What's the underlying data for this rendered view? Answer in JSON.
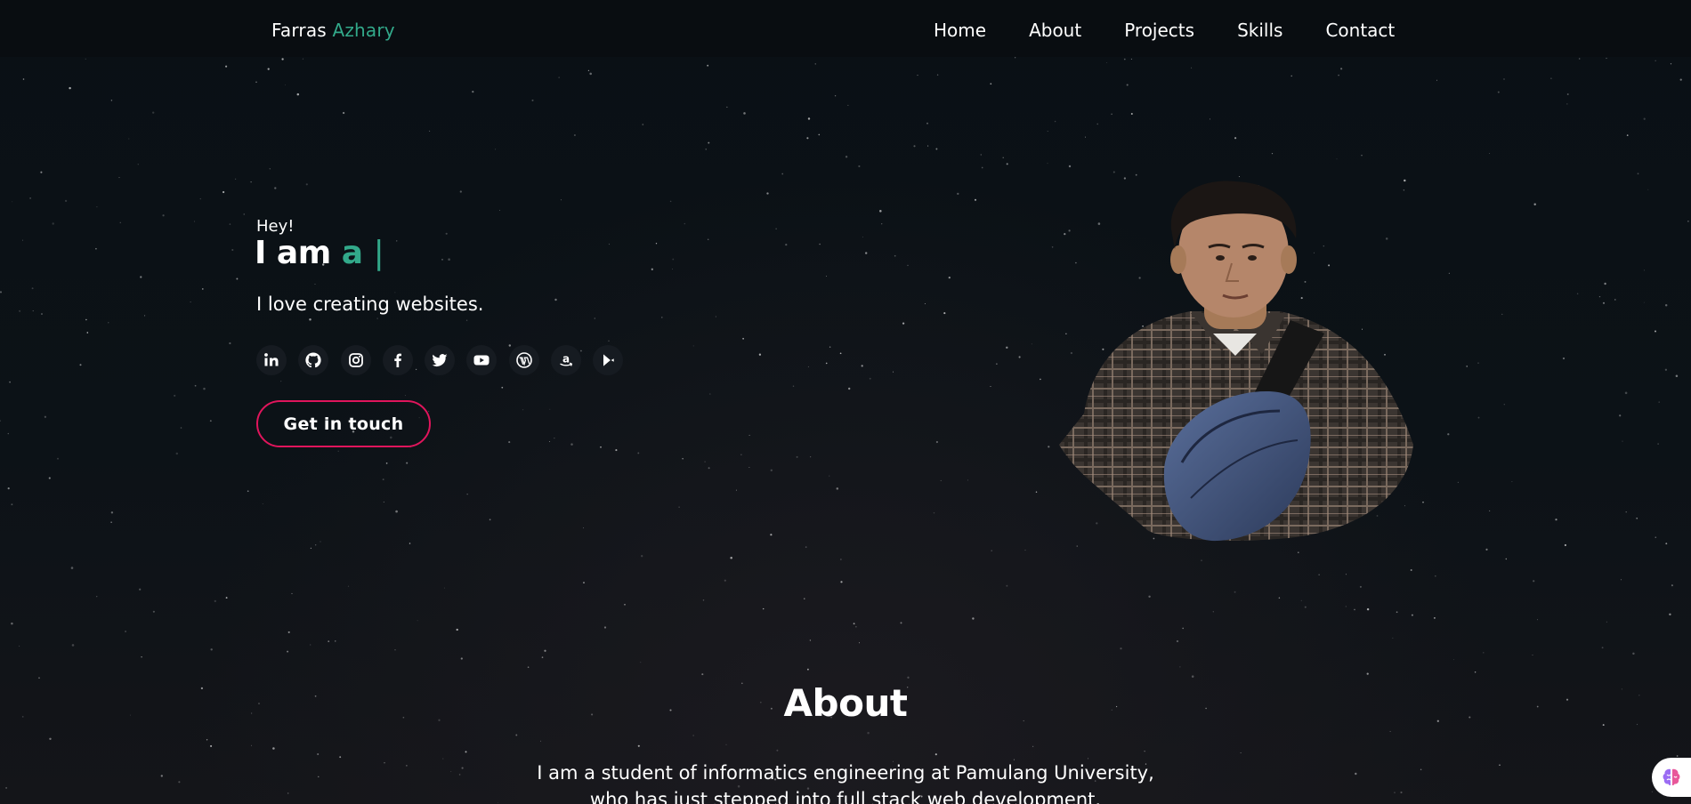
{
  "nav": {
    "brand_first": "Farras",
    "brand_last": "Azhary",
    "links": [
      "Home",
      "About",
      "Projects",
      "Skills",
      "Contact"
    ]
  },
  "hero": {
    "greeting": "Hey!",
    "title_prefix": "I am",
    "typed_text": "a",
    "cursor": "|",
    "tagline": "I love creating websites.",
    "socials": [
      "linkedin-icon",
      "github-icon",
      "instagram-icon",
      "facebook-icon",
      "twitter-icon",
      "youtube-icon",
      "wordpress-icon",
      "amazon-icon",
      "google-play-icon"
    ],
    "cta_label": "Get in touch"
  },
  "about": {
    "title": "About",
    "line1": "I am a student of informatics engineering at Pamulang University,",
    "line2": "who has just stepped into full stack web development."
  },
  "colors": {
    "accent": "#32a98a",
    "cta_border": "#e0155c",
    "background": "#0c1116"
  }
}
